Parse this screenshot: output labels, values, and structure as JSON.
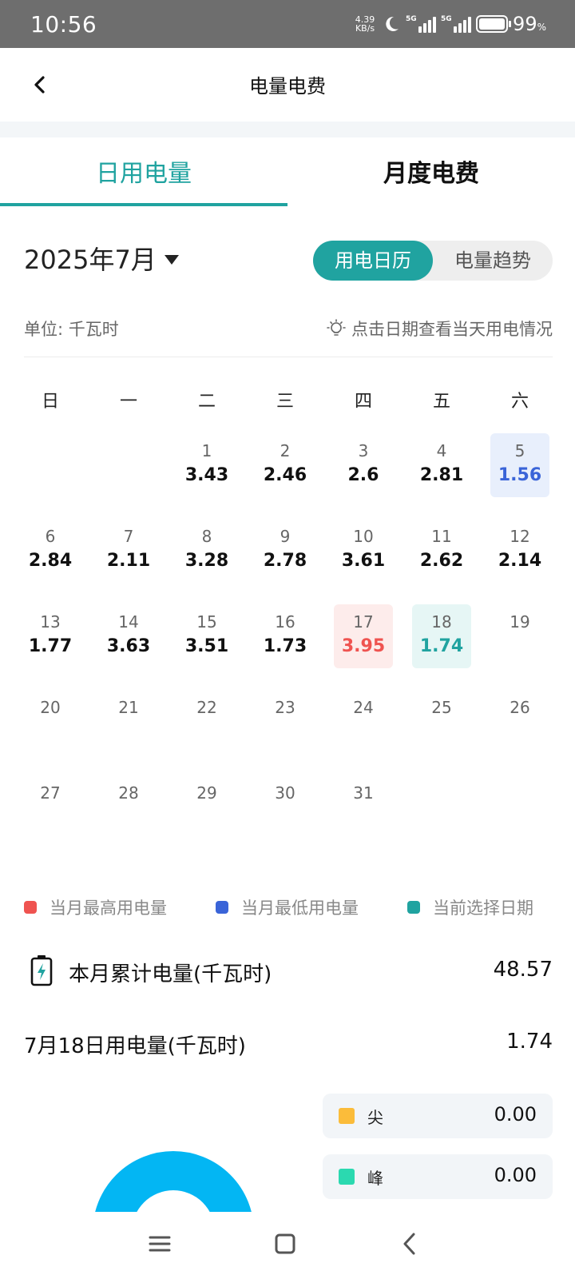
{
  "status": {
    "time": "10:56",
    "speed_value": "4.39",
    "speed_unit": "KB/s",
    "sig1_label": "5G",
    "sig2_label": "5G",
    "battery": "99",
    "battery_unit": "%"
  },
  "header": {
    "title": "电量电费",
    "back_icon": "chevron-left-icon"
  },
  "tabs": [
    {
      "label": "日用电量",
      "active": true
    },
    {
      "label": "月度电费",
      "active": false
    }
  ],
  "month_label": "2025年7月",
  "toggle": {
    "calendar": "用电日历",
    "trend": "电量趋势"
  },
  "unit_label": "单位: 千瓦时",
  "hint": "点击日期查看当天用电情况",
  "weekdays": [
    "日",
    "一",
    "二",
    "三",
    "四",
    "五",
    "六"
  ],
  "days": [
    {
      "day": "1",
      "value": "3.43"
    },
    {
      "day": "2",
      "value": "2.46"
    },
    {
      "day": "3",
      "value": "2.6"
    },
    {
      "day": "4",
      "value": "2.81"
    },
    {
      "day": "5",
      "value": "1.56",
      "state": "low"
    },
    {
      "day": "6",
      "value": "2.84"
    },
    {
      "day": "7",
      "value": "2.11"
    },
    {
      "day": "8",
      "value": "3.28"
    },
    {
      "day": "9",
      "value": "2.78"
    },
    {
      "day": "10",
      "value": "3.61"
    },
    {
      "day": "11",
      "value": "2.62"
    },
    {
      "day": "12",
      "value": "2.14"
    },
    {
      "day": "13",
      "value": "1.77"
    },
    {
      "day": "14",
      "value": "3.63"
    },
    {
      "day": "15",
      "value": "3.51"
    },
    {
      "day": "16",
      "value": "1.73"
    },
    {
      "day": "17",
      "value": "3.95",
      "state": "high"
    },
    {
      "day": "18",
      "value": "1.74",
      "state": "sel"
    },
    {
      "day": "19",
      "value": ""
    },
    {
      "day": "20",
      "value": ""
    },
    {
      "day": "21",
      "value": ""
    },
    {
      "day": "22",
      "value": ""
    },
    {
      "day": "23",
      "value": ""
    },
    {
      "day": "24",
      "value": ""
    },
    {
      "day": "25",
      "value": ""
    },
    {
      "day": "26",
      "value": ""
    },
    {
      "day": "27",
      "value": ""
    },
    {
      "day": "28",
      "value": ""
    },
    {
      "day": "29",
      "value": ""
    },
    {
      "day": "30",
      "value": ""
    },
    {
      "day": "31",
      "value": ""
    }
  ],
  "legend": [
    {
      "label": "当月最高用电量",
      "color": "#ef5350"
    },
    {
      "label": "当月最低用电量",
      "color": "#3a64d8"
    },
    {
      "label": "当前选择日期",
      "color": "#20a3a0"
    }
  ],
  "summary": {
    "month_total_label": "本月累计电量(千瓦时)",
    "month_total_value": "48.57",
    "day_label": "7月18日用电量(千瓦时)",
    "day_value": "1.74"
  },
  "tou": [
    {
      "name": "尖",
      "value": "0.00",
      "color": "#fbbc3a"
    },
    {
      "name": "峰",
      "value": "0.00",
      "color": "#2bd9b0"
    }
  ],
  "colors": {
    "accent": "#20a3a0",
    "donut": "#03b6f3"
  }
}
